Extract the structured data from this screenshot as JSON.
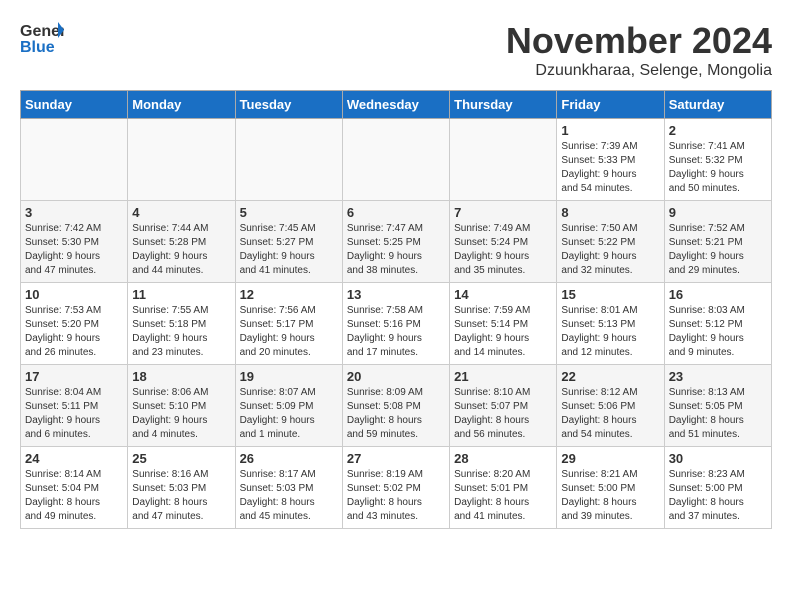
{
  "header": {
    "logo": {
      "line1": "General",
      "line2": "Blue"
    },
    "title": "November 2024",
    "location": "Dzuunkharaa, Selenge, Mongolia"
  },
  "calendar": {
    "headers": [
      "Sunday",
      "Monday",
      "Tuesday",
      "Wednesday",
      "Thursday",
      "Friday",
      "Saturday"
    ],
    "weeks": [
      [
        {
          "day": "",
          "info": ""
        },
        {
          "day": "",
          "info": ""
        },
        {
          "day": "",
          "info": ""
        },
        {
          "day": "",
          "info": ""
        },
        {
          "day": "",
          "info": ""
        },
        {
          "day": "1",
          "info": "Sunrise: 7:39 AM\nSunset: 5:33 PM\nDaylight: 9 hours\nand 54 minutes."
        },
        {
          "day": "2",
          "info": "Sunrise: 7:41 AM\nSunset: 5:32 PM\nDaylight: 9 hours\nand 50 minutes."
        }
      ],
      [
        {
          "day": "3",
          "info": "Sunrise: 7:42 AM\nSunset: 5:30 PM\nDaylight: 9 hours\nand 47 minutes."
        },
        {
          "day": "4",
          "info": "Sunrise: 7:44 AM\nSunset: 5:28 PM\nDaylight: 9 hours\nand 44 minutes."
        },
        {
          "day": "5",
          "info": "Sunrise: 7:45 AM\nSunset: 5:27 PM\nDaylight: 9 hours\nand 41 minutes."
        },
        {
          "day": "6",
          "info": "Sunrise: 7:47 AM\nSunset: 5:25 PM\nDaylight: 9 hours\nand 38 minutes."
        },
        {
          "day": "7",
          "info": "Sunrise: 7:49 AM\nSunset: 5:24 PM\nDaylight: 9 hours\nand 35 minutes."
        },
        {
          "day": "8",
          "info": "Sunrise: 7:50 AM\nSunset: 5:22 PM\nDaylight: 9 hours\nand 32 minutes."
        },
        {
          "day": "9",
          "info": "Sunrise: 7:52 AM\nSunset: 5:21 PM\nDaylight: 9 hours\nand 29 minutes."
        }
      ],
      [
        {
          "day": "10",
          "info": "Sunrise: 7:53 AM\nSunset: 5:20 PM\nDaylight: 9 hours\nand 26 minutes."
        },
        {
          "day": "11",
          "info": "Sunrise: 7:55 AM\nSunset: 5:18 PM\nDaylight: 9 hours\nand 23 minutes."
        },
        {
          "day": "12",
          "info": "Sunrise: 7:56 AM\nSunset: 5:17 PM\nDaylight: 9 hours\nand 20 minutes."
        },
        {
          "day": "13",
          "info": "Sunrise: 7:58 AM\nSunset: 5:16 PM\nDaylight: 9 hours\nand 17 minutes."
        },
        {
          "day": "14",
          "info": "Sunrise: 7:59 AM\nSunset: 5:14 PM\nDaylight: 9 hours\nand 14 minutes."
        },
        {
          "day": "15",
          "info": "Sunrise: 8:01 AM\nSunset: 5:13 PM\nDaylight: 9 hours\nand 12 minutes."
        },
        {
          "day": "16",
          "info": "Sunrise: 8:03 AM\nSunset: 5:12 PM\nDaylight: 9 hours\nand 9 minutes."
        }
      ],
      [
        {
          "day": "17",
          "info": "Sunrise: 8:04 AM\nSunset: 5:11 PM\nDaylight: 9 hours\nand 6 minutes."
        },
        {
          "day": "18",
          "info": "Sunrise: 8:06 AM\nSunset: 5:10 PM\nDaylight: 9 hours\nand 4 minutes."
        },
        {
          "day": "19",
          "info": "Sunrise: 8:07 AM\nSunset: 5:09 PM\nDaylight: 9 hours\nand 1 minute."
        },
        {
          "day": "20",
          "info": "Sunrise: 8:09 AM\nSunset: 5:08 PM\nDaylight: 8 hours\nand 59 minutes."
        },
        {
          "day": "21",
          "info": "Sunrise: 8:10 AM\nSunset: 5:07 PM\nDaylight: 8 hours\nand 56 minutes."
        },
        {
          "day": "22",
          "info": "Sunrise: 8:12 AM\nSunset: 5:06 PM\nDaylight: 8 hours\nand 54 minutes."
        },
        {
          "day": "23",
          "info": "Sunrise: 8:13 AM\nSunset: 5:05 PM\nDaylight: 8 hours\nand 51 minutes."
        }
      ],
      [
        {
          "day": "24",
          "info": "Sunrise: 8:14 AM\nSunset: 5:04 PM\nDaylight: 8 hours\nand 49 minutes."
        },
        {
          "day": "25",
          "info": "Sunrise: 8:16 AM\nSunset: 5:03 PM\nDaylight: 8 hours\nand 47 minutes."
        },
        {
          "day": "26",
          "info": "Sunrise: 8:17 AM\nSunset: 5:03 PM\nDaylight: 8 hours\nand 45 minutes."
        },
        {
          "day": "27",
          "info": "Sunrise: 8:19 AM\nSunset: 5:02 PM\nDaylight: 8 hours\nand 43 minutes."
        },
        {
          "day": "28",
          "info": "Sunrise: 8:20 AM\nSunset: 5:01 PM\nDaylight: 8 hours\nand 41 minutes."
        },
        {
          "day": "29",
          "info": "Sunrise: 8:21 AM\nSunset: 5:00 PM\nDaylight: 8 hours\nand 39 minutes."
        },
        {
          "day": "30",
          "info": "Sunrise: 8:23 AM\nSunset: 5:00 PM\nDaylight: 8 hours\nand 37 minutes."
        }
      ]
    ]
  }
}
